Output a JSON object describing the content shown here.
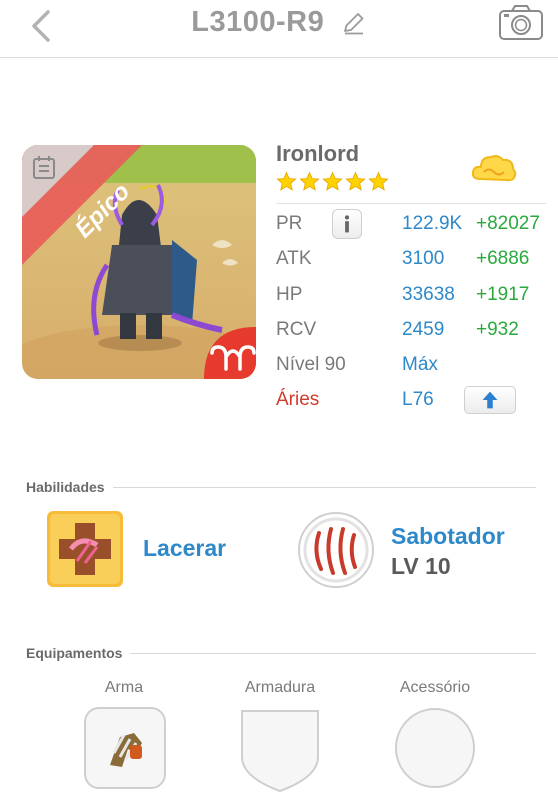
{
  "header": {
    "title": "L3100-R9",
    "icons": {
      "back": "chevron-left-icon",
      "edit": "pencil-icon",
      "camera": "camera-icon"
    }
  },
  "hero": {
    "rarity": "Épico",
    "name": "Ironlord",
    "stars": 5,
    "sign_icon": "aries-icon",
    "element_icon": "cloud-icon"
  },
  "stats": [
    {
      "label": "PR",
      "value": "122.9K",
      "bonus": "+82027"
    },
    {
      "label": "ATK",
      "value": "3100",
      "bonus": "+6886"
    },
    {
      "label": "HP",
      "value": "33638",
      "bonus": "+1917"
    },
    {
      "label": "RCV",
      "value": "2459",
      "bonus": "+932"
    },
    {
      "label": "Nível 90",
      "value": "Máx",
      "bonus": ""
    },
    {
      "label": "Áries",
      "value": "L76",
      "bonus": ""
    }
  ],
  "abilities": {
    "title": "Habilidades",
    "items": [
      {
        "name": "Lacerar",
        "level": ""
      },
      {
        "name": "Sabotador",
        "level": "LV 10"
      }
    ]
  },
  "equipment": {
    "title": "Equipamentos",
    "slots": [
      {
        "label": "Arma",
        "equipped": true
      },
      {
        "label": "Armadura",
        "equipped": false
      },
      {
        "label": "Acessório",
        "equipped": false
      }
    ]
  },
  "colors": {
    "accent_blue": "#2d89c9",
    "bonus_green": "#2aaa3c",
    "zodiac_red": "#d23a2c",
    "star_yellow": "#ffd200",
    "epic_ribbon": "#e8605a"
  }
}
